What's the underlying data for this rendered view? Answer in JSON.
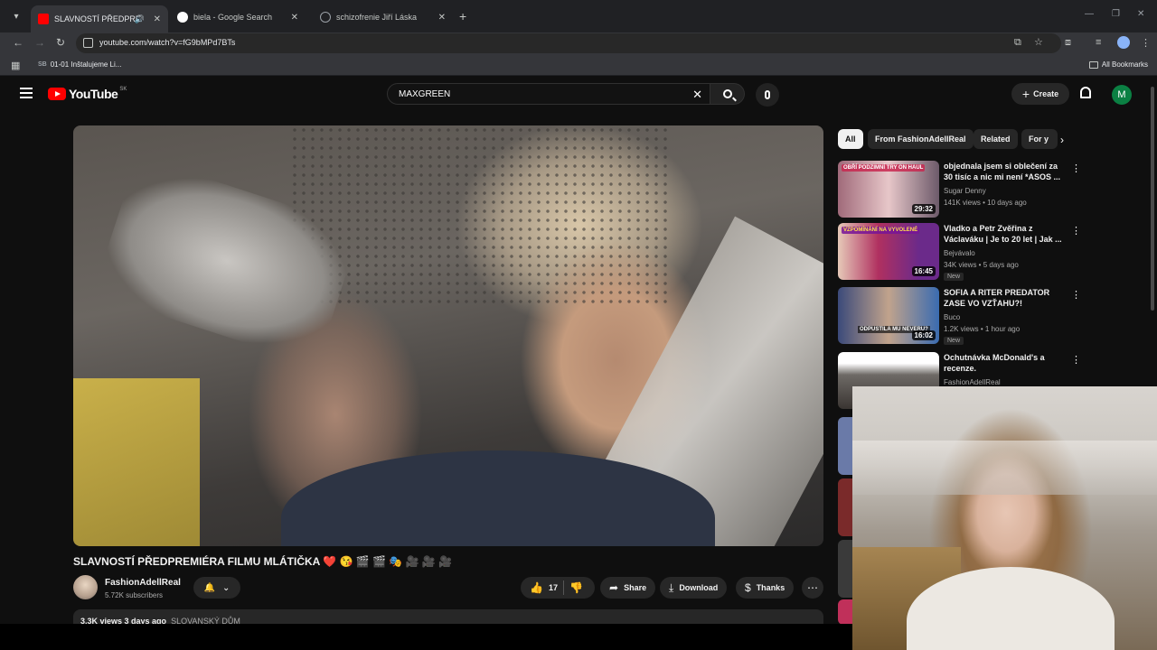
{
  "browser": {
    "tabs": [
      {
        "title": "SLAVNOSTÍ PŘEDPREMIÉRA",
        "favicon_color": "#ff0000",
        "active": true
      },
      {
        "title": "biela - Google Search",
        "favicon_color": "#4285f4",
        "active": false
      },
      {
        "title": "schizofrenie Jiří Láska",
        "favicon_color": "#9aa0a6",
        "active": false
      }
    ],
    "url": "youtube.com/watch?v=fG9bMPd7BTs",
    "bookmarks": [
      {
        "icon_text": "SB",
        "label": "01-01 Inštalujeme Li..."
      }
    ],
    "all_bookmarks_label": "All Bookmarks"
  },
  "youtube": {
    "logo_text": "YouTube",
    "country_code": "SK",
    "search_query": "MAXGREEN",
    "create_label": "Create",
    "avatar_letter": "M"
  },
  "video": {
    "title": "SLAVNOSTÍ PŘEDPREMIÉRA FILMU MLÁTIČKA ❤️ 😘 🎬 🎬 🎭 🎥 🎥 🎥",
    "channel": "FashionAdellReal",
    "subscribers": "5.72K subscribers",
    "likes": "17",
    "share_label": "Share",
    "download_label": "Download",
    "thanks_label": "Thanks",
    "desc_stats": "3.3K views  3 days ago",
    "desc_location": "SLOVANSKÝ DŮM"
  },
  "sidebar": {
    "chips": [
      "All",
      "From FashionAdellReal",
      "Related",
      "For y"
    ],
    "recommendations": [
      {
        "title": "objednala jsem si oblečení za 30 tisíc a nic mi není *ASOS ...",
        "channel": "Sugar Denny",
        "meta": "141K views • 10 days ago",
        "duration": "29:32",
        "badge": "",
        "thumb_text": "OBŘÍ PODZIMNÍ TRY ON HAUL"
      },
      {
        "title": "Vladko a Petr Zvěřina z Václaváku | Je to 20 let | Jak ...",
        "channel": "Bejvávalo",
        "meta": "34K views • 5 days ago",
        "duration": "16:45",
        "badge": "New",
        "thumb_text": "VZPOMÍNÁNÍ NA VYVOLENÉ"
      },
      {
        "title": "SOFIA A RITER PREDATOR ZASE VO VZŤAHU?!",
        "channel": "Buco",
        "meta": "1.2K views • 1 hour ago",
        "duration": "16:02",
        "badge": "New",
        "thumb_text": "ODPUSTILA MU NEVERU?"
      },
      {
        "title": "Ochutnávka McDonald's a recenze.",
        "channel": "FashionAdellReal",
        "meta": "",
        "duration": "",
        "badge": "",
        "thumb_text": ""
      }
    ]
  }
}
